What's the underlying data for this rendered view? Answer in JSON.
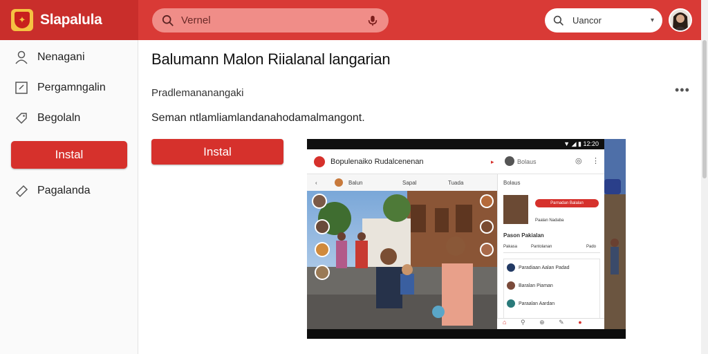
{
  "app": {
    "name": "Slapalula"
  },
  "search": {
    "placeholder": "Vernel"
  },
  "language": {
    "label": "Uancor"
  },
  "sidebar": {
    "items": [
      {
        "label": "Nenagani"
      },
      {
        "label": "Pergamngalin"
      },
      {
        "label": "Begolaln"
      },
      {
        "label": "Instal"
      },
      {
        "label": "Pagalanda"
      }
    ]
  },
  "main": {
    "title": "Balumann Malon Riialanal langarian",
    "subtitle": "Pradlemananangaki",
    "description": "Seman ntlamliamlandanahodamalmangont.",
    "install_label": "Instal"
  },
  "screenshot": {
    "status_time": "12:20",
    "app_title": "Bopulenaiko Rudalcenenan",
    "tab_labels": [
      "Balun",
      "Sapal",
      "Tuada"
    ],
    "panel_header": "Bolaus",
    "panel_button": "Parnadan Balalan",
    "panel_title": "Pason Pakialan",
    "panel_link": "Paalan Nadaba",
    "panel_tabs": [
      "Pakasa",
      "Pantolanan",
      "Pado"
    ],
    "list": [
      "Paradiaan Aalan Padad",
      "Baralan Piaman",
      "Paraalan Aardan"
    ]
  },
  "colors": {
    "accent": "#d6312c",
    "topbar": "#d93a36",
    "brand_bg": "#c92e2b"
  }
}
